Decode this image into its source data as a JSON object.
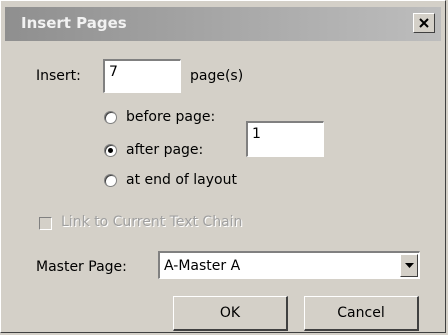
{
  "window": {
    "title": "Insert Pages",
    "close_icon": "close-icon"
  },
  "insert": {
    "label": "Insert:",
    "count_value": "7",
    "unit_label": "page(s)"
  },
  "position_options": [
    {
      "label": "before page:",
      "selected": false
    },
    {
      "label": "after page:",
      "selected": true
    },
    {
      "label": "at end of layout",
      "selected": false
    }
  ],
  "page_number_value": "1",
  "link_checkbox": {
    "label": "Link to Current Text Chain",
    "checked": false,
    "enabled": false
  },
  "master_page": {
    "label": "Master Page:",
    "selected": "A-Master A"
  },
  "buttons": {
    "ok": "OK",
    "cancel": "Cancel"
  }
}
